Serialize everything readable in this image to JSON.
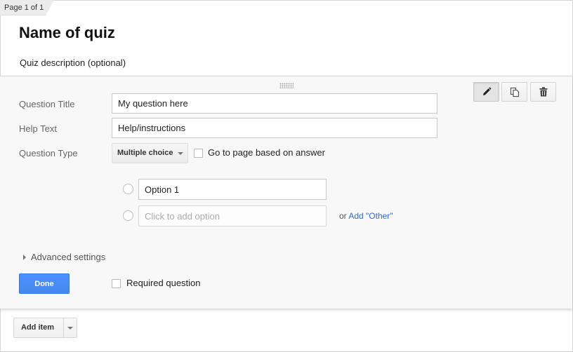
{
  "page_indicator": "Page 1 of 1",
  "quiz": {
    "title": "Name of quiz",
    "description": "Quiz description (optional)"
  },
  "question": {
    "toolbar": {
      "edit_icon": "pencil-icon",
      "duplicate_icon": "duplicate-icon",
      "delete_icon": "trash-icon"
    },
    "labels": {
      "title": "Question Title",
      "help": "Help Text",
      "type": "Question Type"
    },
    "title_value": "My question here",
    "help_value": "Help/instructions",
    "type_value": "Multiple choice",
    "go_to_page_label": "Go to page based on answer",
    "options": [
      {
        "value": "Option 1"
      }
    ],
    "add_option_placeholder": "Click to add option",
    "or_text": "or",
    "add_other_label": "Add \"Other\"",
    "advanced_settings": "Advanced settings",
    "done_label": "Done",
    "required_label": "Required question"
  },
  "add_item": {
    "label": "Add item"
  },
  "colors": {
    "primary_button": "#4d90fe",
    "link": "#3366cc",
    "card_background": "#f8f8f8"
  }
}
